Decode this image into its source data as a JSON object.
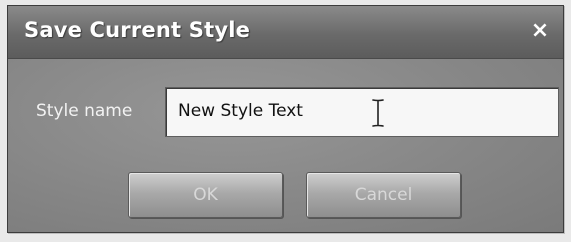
{
  "dialog": {
    "title": "Save Current Style",
    "close_label": "×"
  },
  "form": {
    "style_name_label": "Style name",
    "style_name_value": "New Style Text"
  },
  "buttons": {
    "ok_label": "OK",
    "cancel_label": "Cancel"
  }
}
